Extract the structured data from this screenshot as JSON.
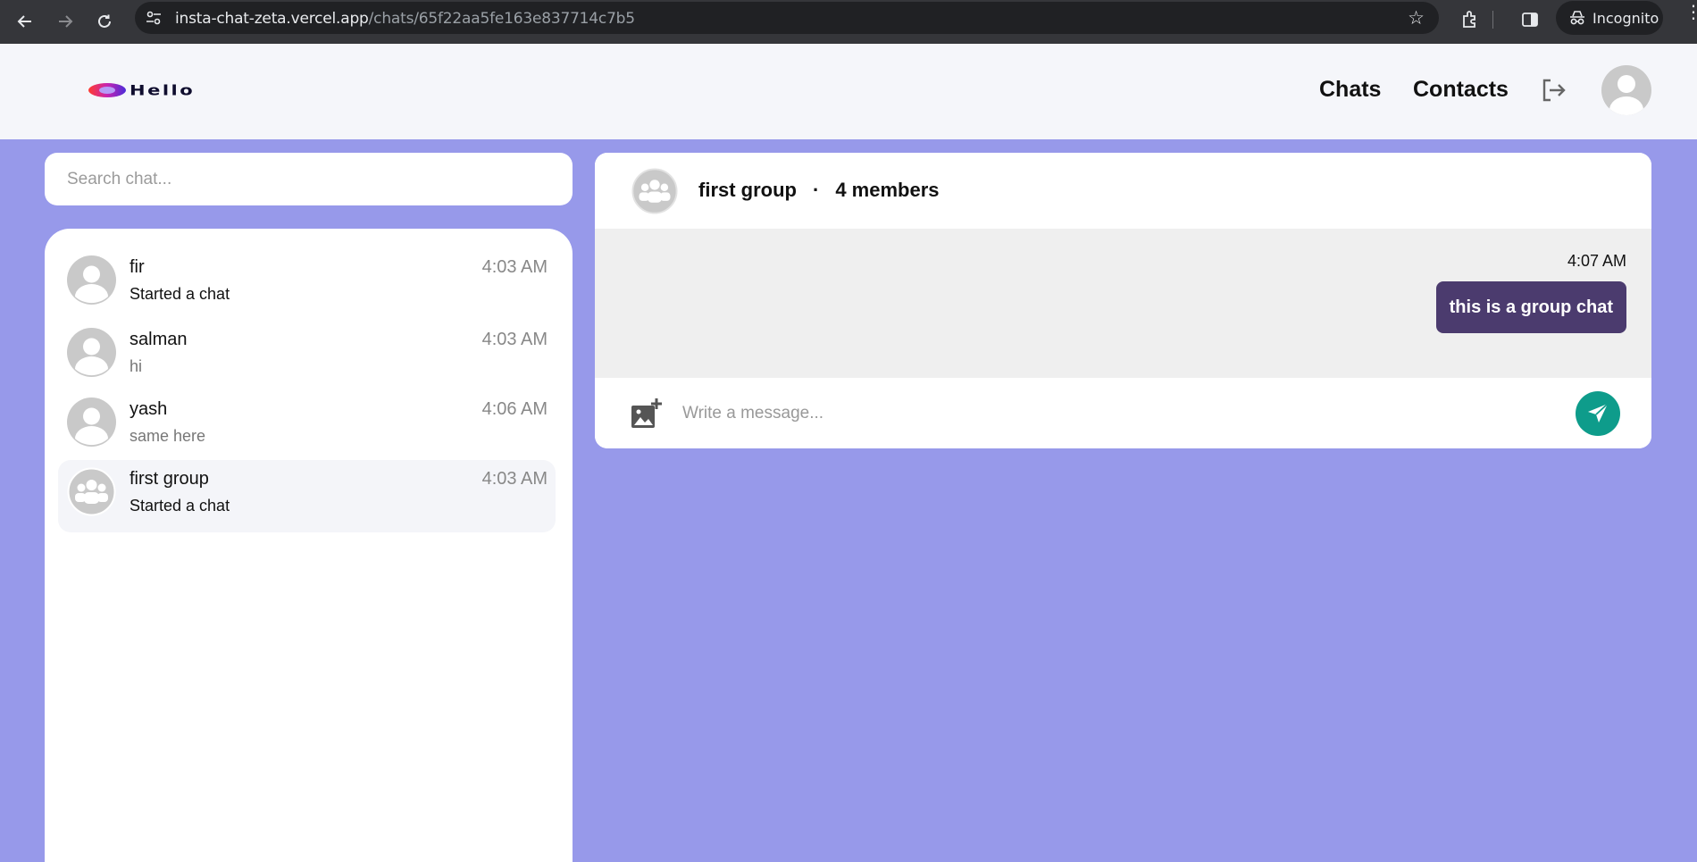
{
  "browser": {
    "url_host": "insta-chat-zeta.vercel.app",
    "url_path": "/chats/65f22aa5fe163e837714c7b5",
    "incognito_label": "Incognito",
    "back_icon": "arrow-left-icon",
    "forward_icon": "arrow-right-icon",
    "reload_icon": "reload-icon",
    "bookmark_icon": "star-icon"
  },
  "header": {
    "logo_text": "Hello",
    "nav": {
      "chats": "Chats",
      "contacts": "Contacts"
    },
    "logout_icon": "logout-icon",
    "profile_icon": "user-avatar"
  },
  "search": {
    "placeholder": "Search chat..."
  },
  "chat_list": [
    {
      "name": "fir",
      "last_message": "Started a chat",
      "time": "4:03 AM",
      "type": "user",
      "active": false
    },
    {
      "name": "salman",
      "last_message": "hi",
      "time": "4:03 AM",
      "type": "user",
      "active": false
    },
    {
      "name": "yash",
      "last_message": "same here",
      "time": "4:06 AM",
      "type": "user",
      "active": false
    },
    {
      "name": "first group",
      "last_message": "Started a chat",
      "time": "4:03 AM",
      "type": "group",
      "active": true
    }
  ],
  "conversation": {
    "title": "first group",
    "separator": "·",
    "members": "4 members",
    "messages": [
      {
        "time": "4:07 AM",
        "text": "this is a group chat",
        "outgoing": true
      }
    ],
    "composer_placeholder": "Write a message...",
    "attach_icon": "add-photo-icon",
    "send_icon": "send-icon"
  },
  "colors": {
    "page_background": "#9799ea",
    "header_background": "#f5f6fa",
    "bubble": "#4b3b6e",
    "send_button": "#0e9c8b"
  }
}
